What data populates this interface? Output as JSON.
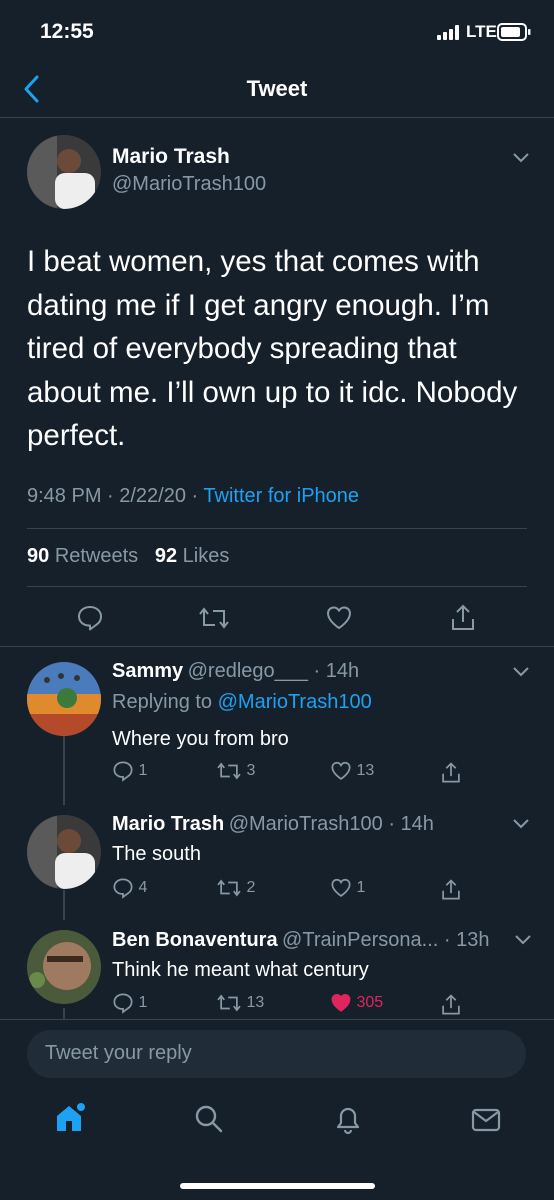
{
  "status": {
    "time": "12:55",
    "network": "LTE"
  },
  "header": {
    "title": "Tweet"
  },
  "main_tweet": {
    "name": "Mario Trash",
    "handle": "@MarioTrash100",
    "text": "I beat women, yes that comes with dating me if I get angry enough. I’m tired of everybody spreading that about me. I’ll own up to it idc. Nobody perfect.",
    "time": "9:48 PM · 2/22/20 · ",
    "source": "Twitter for iPhone",
    "retweets": "90",
    "retweets_label": "Retweets",
    "likes": "92",
    "likes_label": "Likes"
  },
  "replies": [
    {
      "name": "Sammy",
      "meta": "@redlego___ · 14h",
      "replying_prefix": "Replying to ",
      "replying_handle": "@MarioTrash100",
      "text": "Where you from bro",
      "reply_count": "1",
      "retweet_count": "3",
      "like_count": "13"
    },
    {
      "name": "Mario Trash",
      "meta": "@MarioTrash100 · 14h",
      "text": "The south",
      "reply_count": "4",
      "retweet_count": "2",
      "like_count": "1"
    },
    {
      "name": "Ben Bonaventura",
      "meta": "@TrainPersona... · 13h",
      "text": "Think he meant what century",
      "reply_count": "1",
      "retweet_count": "13",
      "like_count": "305"
    }
  ],
  "composer": {
    "placeholder": "Tweet your reply"
  },
  "colors": {
    "background": "#15202b",
    "accent": "#1da1f2",
    "like_active": "#e0245e",
    "muted": "#8899a6"
  }
}
